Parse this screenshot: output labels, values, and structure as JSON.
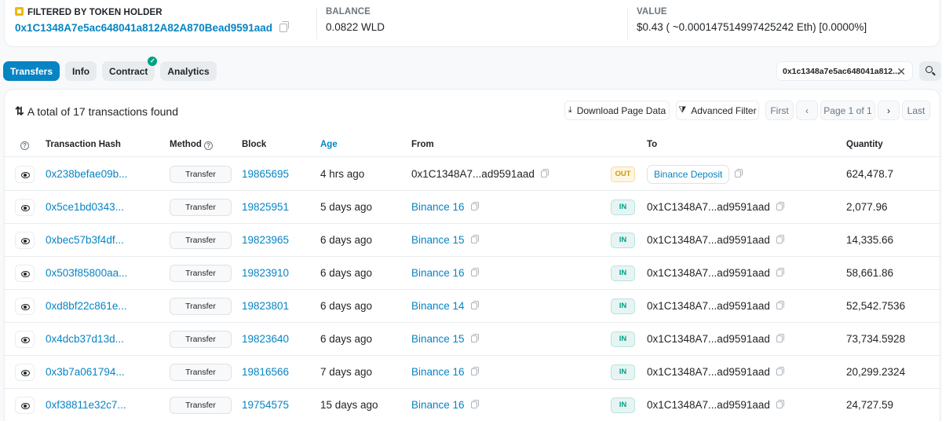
{
  "summary": {
    "holder_label": "FILTERED BY TOKEN HOLDER",
    "holder_address": "0x1C1348A7e5ac648041a812A82A870Bead9591aad",
    "balance_label": "BALANCE",
    "balance_value": "0.0822 WLD",
    "value_label": "VALUE",
    "value_value": "$0.43 ( ~0.000147514997425242 Eth) [0.0000%]"
  },
  "tabs": [
    {
      "label": "Transfers",
      "active": true
    },
    {
      "label": "Info"
    },
    {
      "label": "Contract",
      "verified": true
    },
    {
      "label": "Analytics"
    }
  ],
  "filter_chip": "0x1c1348a7e5ac648041a812...",
  "total_text": "A total of 17 transactions found",
  "toolbar": {
    "download": "Download Page Data",
    "advanced": "Advanced Filter",
    "first": "First",
    "page": "Page 1 of 1",
    "last": "Last"
  },
  "columns": {
    "hash": "Transaction Hash",
    "method": "Method",
    "block": "Block",
    "age": "Age",
    "from": "From",
    "to": "To",
    "quantity": "Quantity"
  },
  "rows": [
    {
      "hash": "0x238befae09b...",
      "method": "Transfer",
      "block": "19865695",
      "age": "4 hrs ago",
      "from": "0x1C1348A7...ad9591aad",
      "direction": "OUT",
      "to": "Binance Deposit",
      "quantity": "624,478.7"
    },
    {
      "hash": "0x5ce1bd0343...",
      "method": "Transfer",
      "block": "19825951",
      "age": "5 days ago",
      "from": "Binance 16",
      "direction": "IN",
      "to": "0x1C1348A7...ad9591aad",
      "quantity": "2,077.96"
    },
    {
      "hash": "0xbec57b3f4df...",
      "method": "Transfer",
      "block": "19823965",
      "age": "6 days ago",
      "from": "Binance 15",
      "direction": "IN",
      "to": "0x1C1348A7...ad9591aad",
      "quantity": "14,335.66"
    },
    {
      "hash": "0x503f85800aa...",
      "method": "Transfer",
      "block": "19823910",
      "age": "6 days ago",
      "from": "Binance 16",
      "direction": "IN",
      "to": "0x1C1348A7...ad9591aad",
      "quantity": "58,661.86"
    },
    {
      "hash": "0xd8bf22c861e...",
      "method": "Transfer",
      "block": "19823801",
      "age": "6 days ago",
      "from": "Binance 14",
      "direction": "IN",
      "to": "0x1C1348A7...ad9591aad",
      "quantity": "52,542.7536"
    },
    {
      "hash": "0x4dcb37d13d...",
      "method": "Transfer",
      "block": "19823640",
      "age": "6 days ago",
      "from": "Binance 15",
      "direction": "IN",
      "to": "0x1C1348A7...ad9591aad",
      "quantity": "73,734.5928"
    },
    {
      "hash": "0x3b7a061794...",
      "method": "Transfer",
      "block": "19816566",
      "age": "7 days ago",
      "from": "Binance 16",
      "direction": "IN",
      "to": "0x1C1348A7...ad9591aad",
      "quantity": "20,299.2324"
    },
    {
      "hash": "0xf38811e32c7...",
      "method": "Transfer",
      "block": "19754575",
      "age": "15 days ago",
      "from": "Binance 16",
      "direction": "IN",
      "to": "0x1C1348A7...ad9591aad",
      "quantity": "24,727.59"
    }
  ],
  "colors": {
    "link": "#0784c3",
    "in": "#00a186",
    "out": "#cc9a06",
    "accent": "#0784c3"
  }
}
